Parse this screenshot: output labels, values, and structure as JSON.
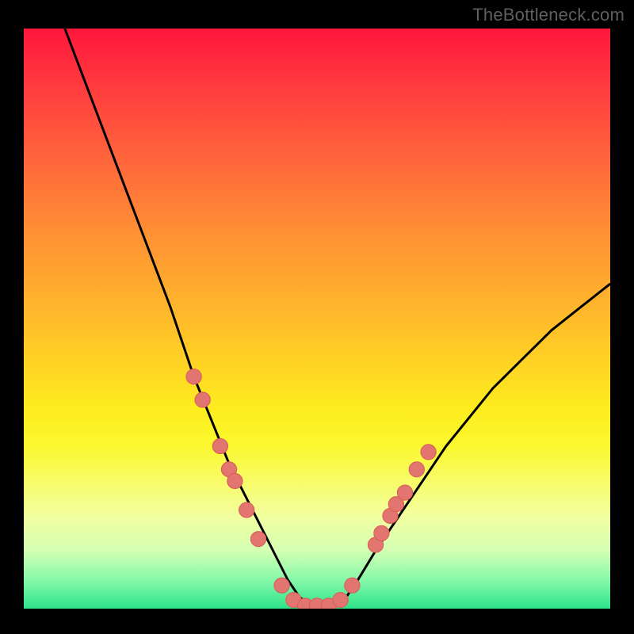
{
  "attribution": "TheBottleneck.com",
  "colors": {
    "frame": "#000000",
    "gradient_top": "#ff163c",
    "gradient_bottom": "#2ee38a",
    "curve": "#000000",
    "marker_fill": "#e2756f",
    "marker_stroke": "#d85f59"
  },
  "chart_data": {
    "type": "line",
    "title": "",
    "xlabel": "",
    "ylabel": "",
    "xlim": [
      0,
      100
    ],
    "ylim": [
      0,
      100
    ],
    "series": [
      {
        "name": "bottleneck-curve",
        "x": [
          7,
          10,
          13,
          16,
          19,
          22,
          25,
          27,
          29,
          31,
          33,
          35,
          37,
          39,
          41,
          43,
          45,
          47,
          49,
          51,
          53,
          55,
          57,
          60,
          64,
          68,
          72,
          76,
          80,
          85,
          90,
          95,
          100
        ],
        "y": [
          100,
          92,
          84,
          76,
          68,
          60,
          52,
          46,
          40,
          35,
          30,
          25,
          21,
          17,
          13,
          9,
          5,
          2,
          0.5,
          0.5,
          0.5,
          2,
          5,
          10,
          16,
          22,
          28,
          33,
          38,
          43,
          48,
          52,
          56
        ]
      }
    ],
    "markers": {
      "name": "highlight-dots",
      "points": [
        {
          "x": 29,
          "y": 40
        },
        {
          "x": 30.5,
          "y": 36
        },
        {
          "x": 33.5,
          "y": 28
        },
        {
          "x": 35,
          "y": 24
        },
        {
          "x": 36,
          "y": 22
        },
        {
          "x": 38,
          "y": 17
        },
        {
          "x": 40,
          "y": 12
        },
        {
          "x": 44,
          "y": 4
        },
        {
          "x": 46,
          "y": 1.5
        },
        {
          "x": 48,
          "y": 0.5
        },
        {
          "x": 50,
          "y": 0.5
        },
        {
          "x": 52,
          "y": 0.5
        },
        {
          "x": 54,
          "y": 1.5
        },
        {
          "x": 56,
          "y": 4
        },
        {
          "x": 60,
          "y": 11
        },
        {
          "x": 61,
          "y": 13
        },
        {
          "x": 62.5,
          "y": 16
        },
        {
          "x": 63.5,
          "y": 18
        },
        {
          "x": 65,
          "y": 20
        },
        {
          "x": 67,
          "y": 24
        },
        {
          "x": 69,
          "y": 27
        }
      ]
    }
  }
}
